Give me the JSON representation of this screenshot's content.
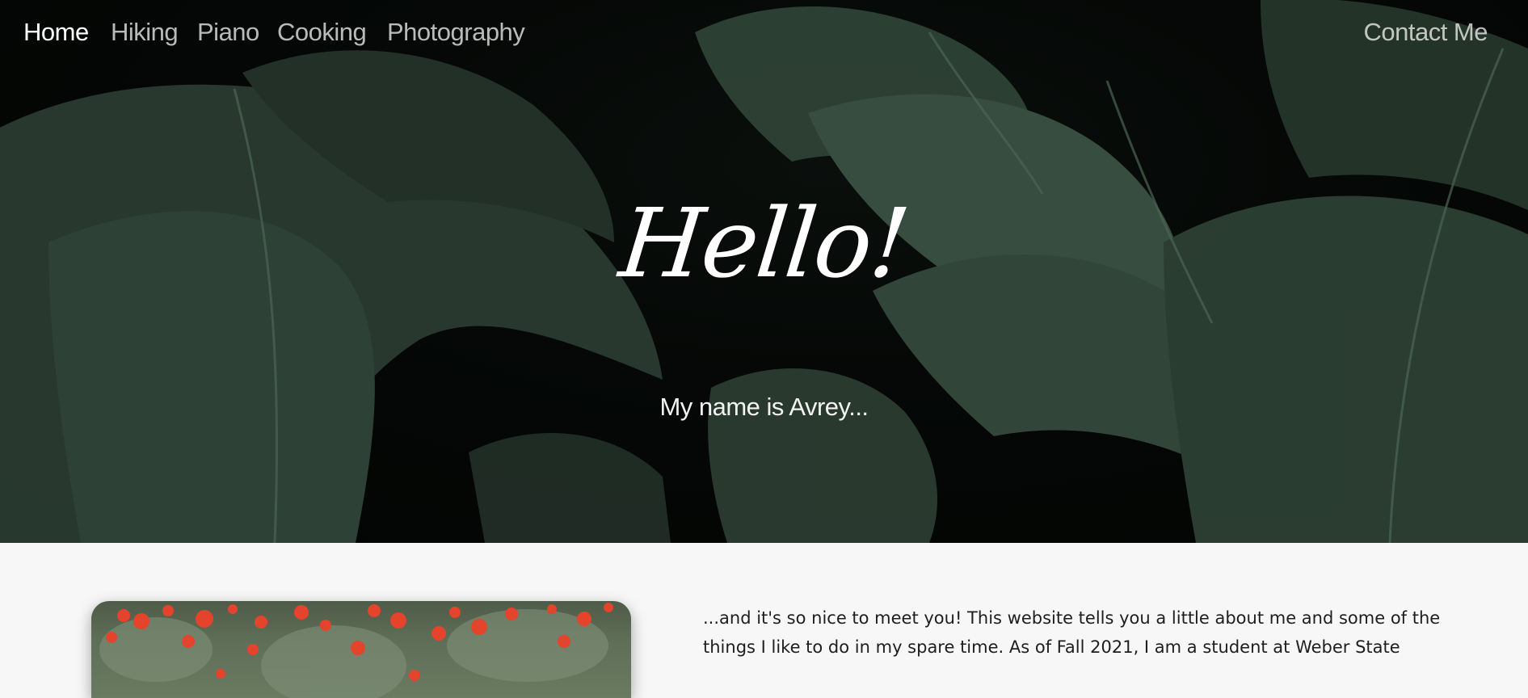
{
  "nav": {
    "items": [
      {
        "label": "Home",
        "active": true
      },
      {
        "label": "Hiking",
        "active": false
      },
      {
        "label": "Piano",
        "active": false
      },
      {
        "label": "Cooking",
        "active": false
      },
      {
        "label": "Photography",
        "active": false
      }
    ],
    "contact_label": "Contact Me"
  },
  "hero": {
    "title": "Hello!",
    "subtitle": "My name is Avrey..."
  },
  "about": {
    "text": "...and it's so nice to meet you! This website tells you a little about me and some of the things I like to do in my spare time. As of Fall 2021, I am a student at Weber State"
  },
  "colors": {
    "leaf": "#2e4035",
    "leaf_light": "#3f5646",
    "poppy": "#e4432c",
    "text_dark": "#1e1e1e"
  }
}
